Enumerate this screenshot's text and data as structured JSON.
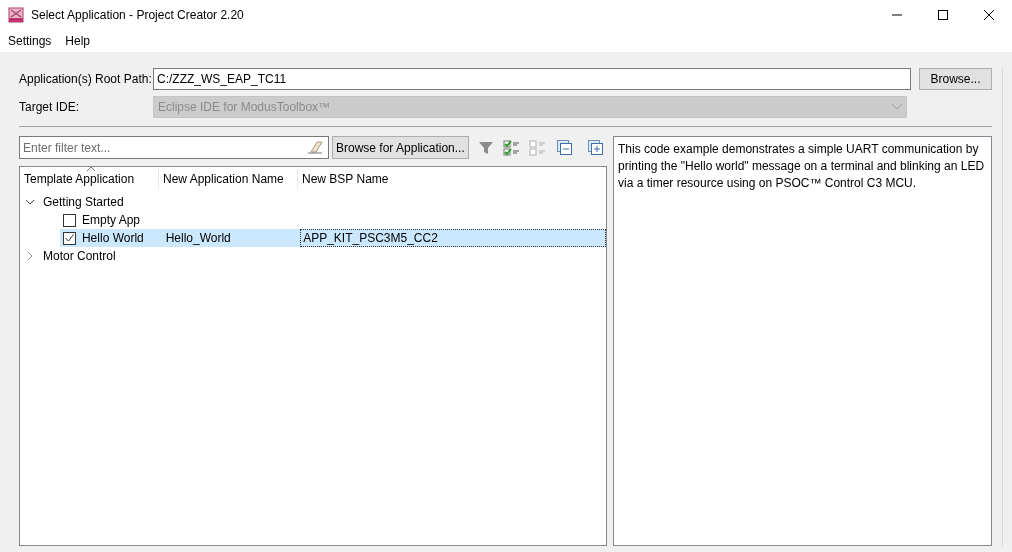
{
  "window": {
    "title": "Select Application - Project Creator 2.20"
  },
  "menu": [
    "Settings",
    "Help"
  ],
  "root_path": {
    "label": "Application(s) Root Path:",
    "value": "C:/ZZZ_WS_EAP_TC11",
    "button": "Browse..."
  },
  "target_ide": {
    "label": "Target IDE:",
    "value": "Eclipse IDE for ModusToolbox™",
    "disabled": true
  },
  "filter": {
    "placeholder": "Enter filter text...",
    "button": "Browse for Application..."
  },
  "tree": {
    "columns": [
      "Template Application",
      "New Application Name",
      "New BSP Name"
    ],
    "items": [
      {
        "label": "Getting Started",
        "expanded": true,
        "children": [
          {
            "label": "Empty App",
            "checked": false,
            "selected": false
          },
          {
            "label": "Hello World",
            "checked": true,
            "selected": true,
            "app_name": "Hello_World",
            "bsp_name": "APP_KIT_PSC3M5_CC2"
          }
        ]
      },
      {
        "label": "Motor Control",
        "expanded": false
      }
    ]
  },
  "description": "This code example demonstrates a simple UART communication by printing the \"Hello world\" message on a terminal and blinking an LED via a timer resource using on PSOC™ Control C3 MCU."
}
